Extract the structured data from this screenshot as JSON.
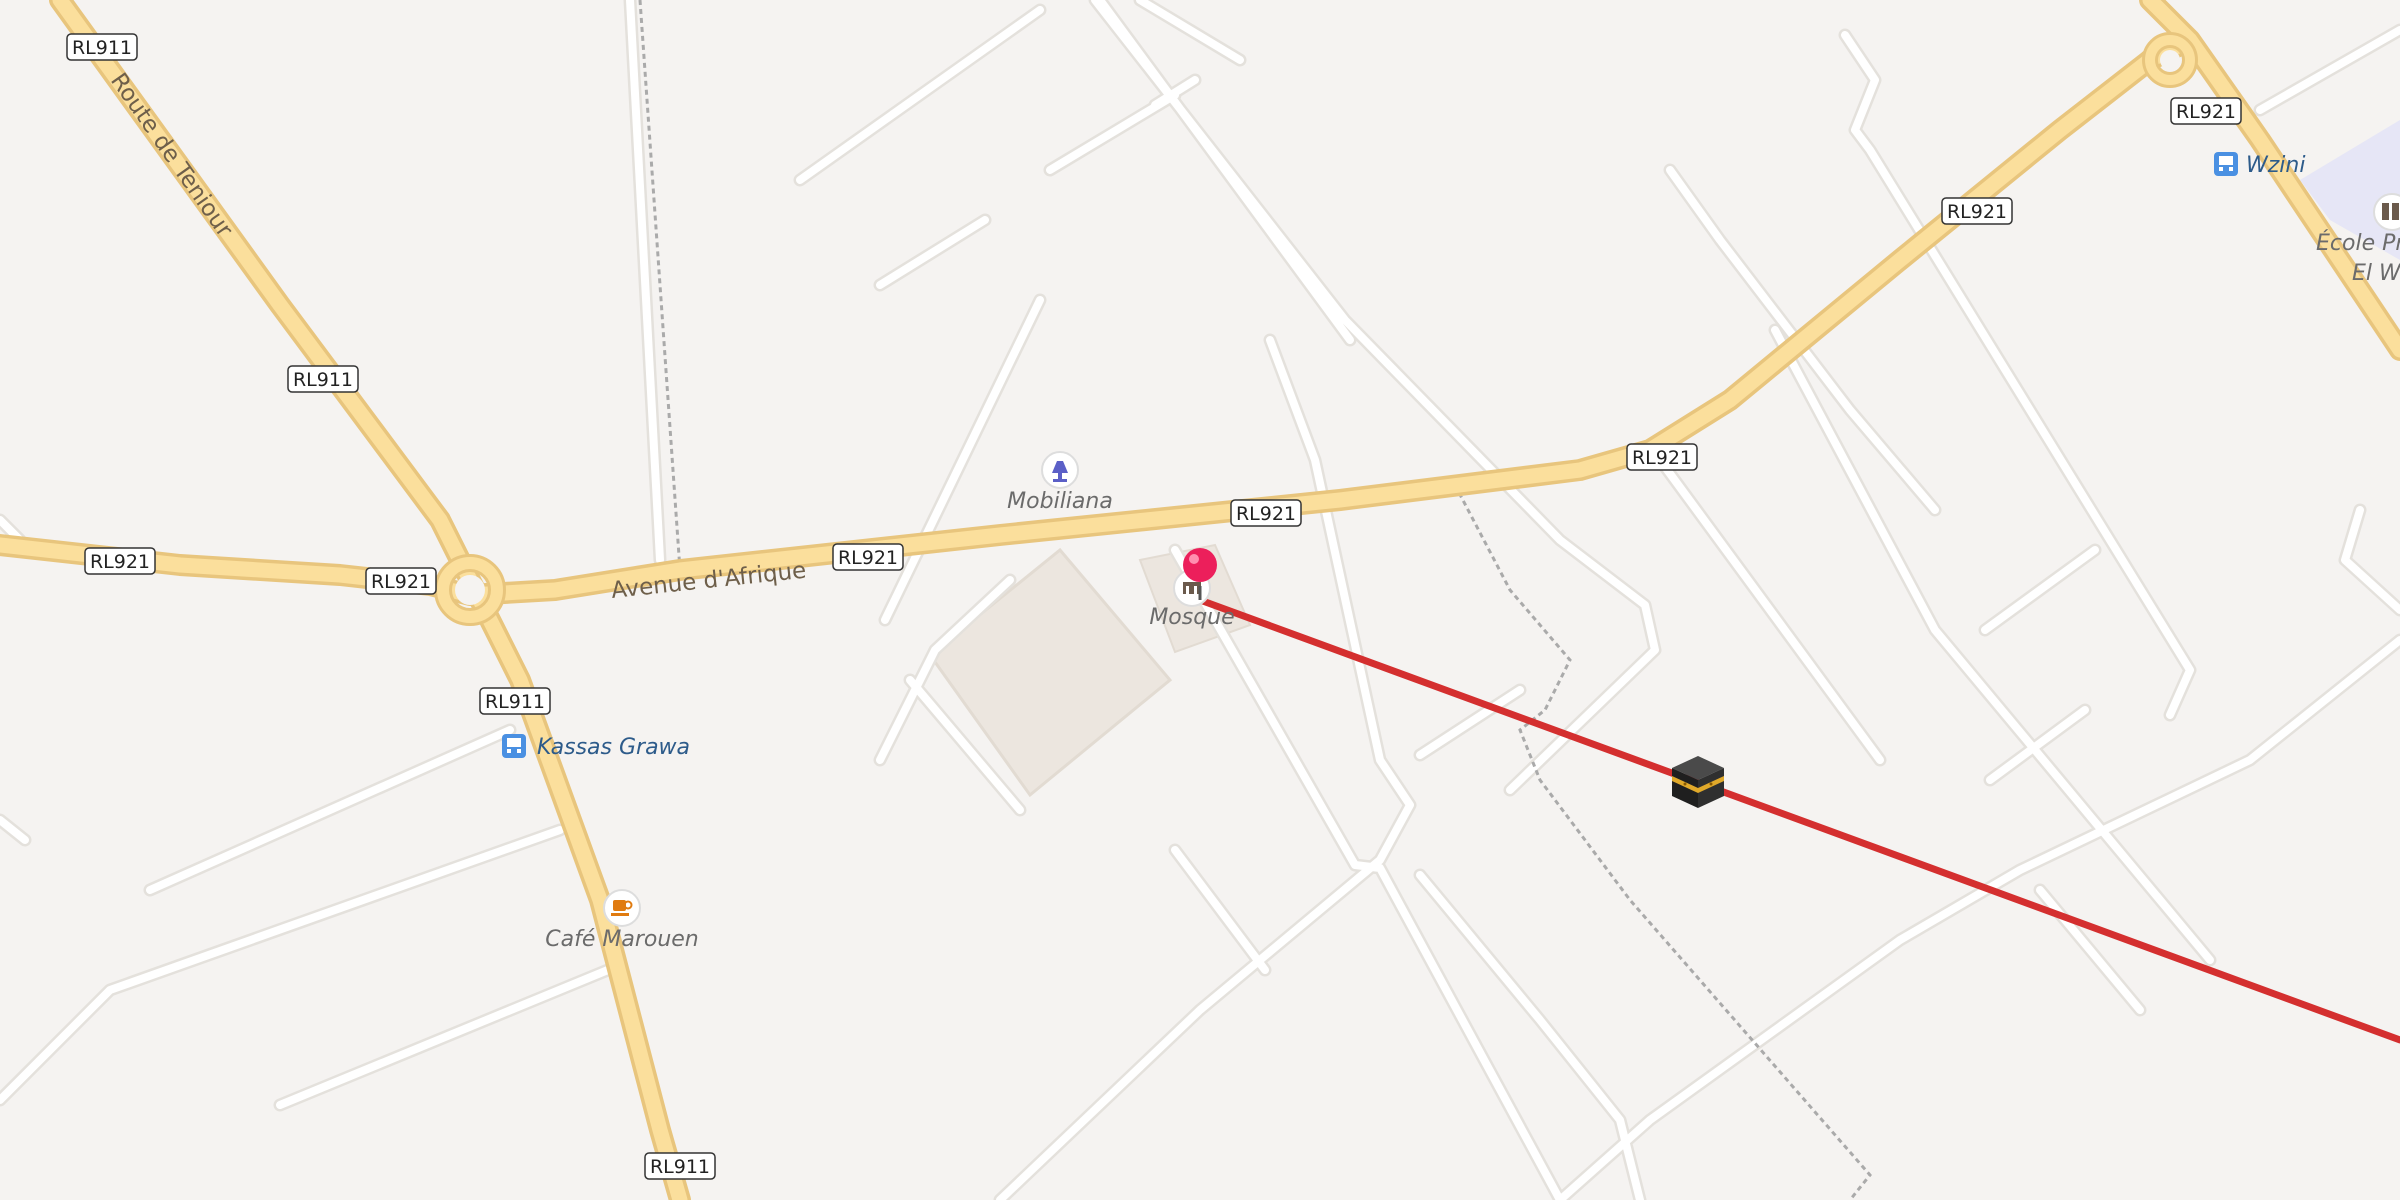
{
  "map": {
    "colors": {
      "background": "#f5f3f1",
      "primary_road": "#fbdf9c",
      "primary_road_casing": "#e8c57d",
      "minor_road": "#ffffff",
      "minor_road_casing": "#e4e1dc",
      "route_line": "#d42f2f",
      "pin": "#ec1f5b",
      "transit": "#4a90e2",
      "school_area": "#e6e6f6"
    },
    "route_shields": [
      {
        "label": "RL911"
      },
      {
        "label": "RL911"
      },
      {
        "label": "RL911"
      },
      {
        "label": "RL911"
      },
      {
        "label": "RL921"
      },
      {
        "label": "RL921"
      },
      {
        "label": "RL921"
      },
      {
        "label": "RL921"
      },
      {
        "label": "RL921"
      },
      {
        "label": "RL921"
      },
      {
        "label": "RL921"
      }
    ],
    "road_names": [
      {
        "label": "Route de Teniour"
      },
      {
        "label": "Avenue d'Afrique"
      }
    ],
    "pois": [
      {
        "label": "Mobiliana",
        "icon": "lamp-icon"
      },
      {
        "label": "Mosque",
        "icon": "mosque-icon"
      },
      {
        "label": "Café Marouen",
        "icon": "coffee-icon"
      },
      {
        "label": "École Pri",
        "icon": "school-icon"
      },
      {
        "label": "El We",
        "icon": ""
      }
    ],
    "transit_stops": [
      {
        "label": "Kassas Grawa",
        "icon": "bus-stop-icon"
      },
      {
        "label": "Wzini",
        "icon": "bus-stop-icon"
      }
    ],
    "markers": {
      "pin": "location-pin-icon",
      "kaaba": "kaaba-icon"
    }
  }
}
